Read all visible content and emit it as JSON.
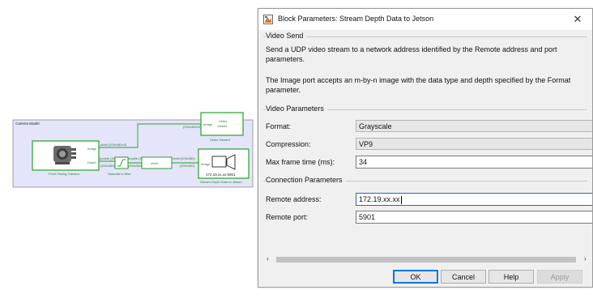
{
  "model": {
    "subsystem_title": "Camera Model",
    "blocks": {
      "camera": {
        "label": "Front Facing Camera",
        "port_image": "Image",
        "port_depth": "Depth"
      },
      "saturate": {
        "label": "Saturate to 80m"
      },
      "uint8": {
        "label": "uint8"
      },
      "viewer": {
        "label": "Video Viewer1",
        "text": "Video\nViewer",
        "port": "Image"
      },
      "stream": {
        "label": "Stream Depth Data to Jetson",
        "port": "Image",
        "address": "172.19.xx.xx:5901"
      }
    },
    "signal_labels": {
      "image_top": "uint8 (200x360x3)",
      "image_bottom": "(200x360x3)",
      "depth_top1": "double (200x360)",
      "depth_bottom1": "(200x360)",
      "depth_top2": "double (200x360)",
      "depth_bottom2": "(200x360)",
      "uint8_top": "uint8 (200x360)",
      "uint8_bottom": "(200x360)"
    }
  },
  "dialog": {
    "title": "Block Parameters: Stream Depth Data to Jetson",
    "close_label": "✕",
    "section_video_send": "Video Send",
    "description1": "Send a UDP video stream to a network address identified by the Remote address and port parameters.",
    "description2": "The Image port accepts an m-by-n image with the data type and depth specified by the Format parameter.",
    "section_video_params": "Video Parameters",
    "format_label": "Format:",
    "format_value": "Grayscale",
    "compression_label": "Compression:",
    "compression_value": "VP9",
    "max_frame_label": "Max frame time (ms):",
    "max_frame_value": "34",
    "section_connection": "Connection Parameters",
    "remote_address_label": "Remote address:",
    "remote_address_value": "172.19.xx.xx",
    "remote_port_label": "Remote port:",
    "remote_port_value": "5901",
    "buttons": {
      "ok": "OK",
      "cancel": "Cancel",
      "help": "Help",
      "apply": "Apply"
    },
    "scroll_left": "‹",
    "scroll_right": "›"
  }
}
